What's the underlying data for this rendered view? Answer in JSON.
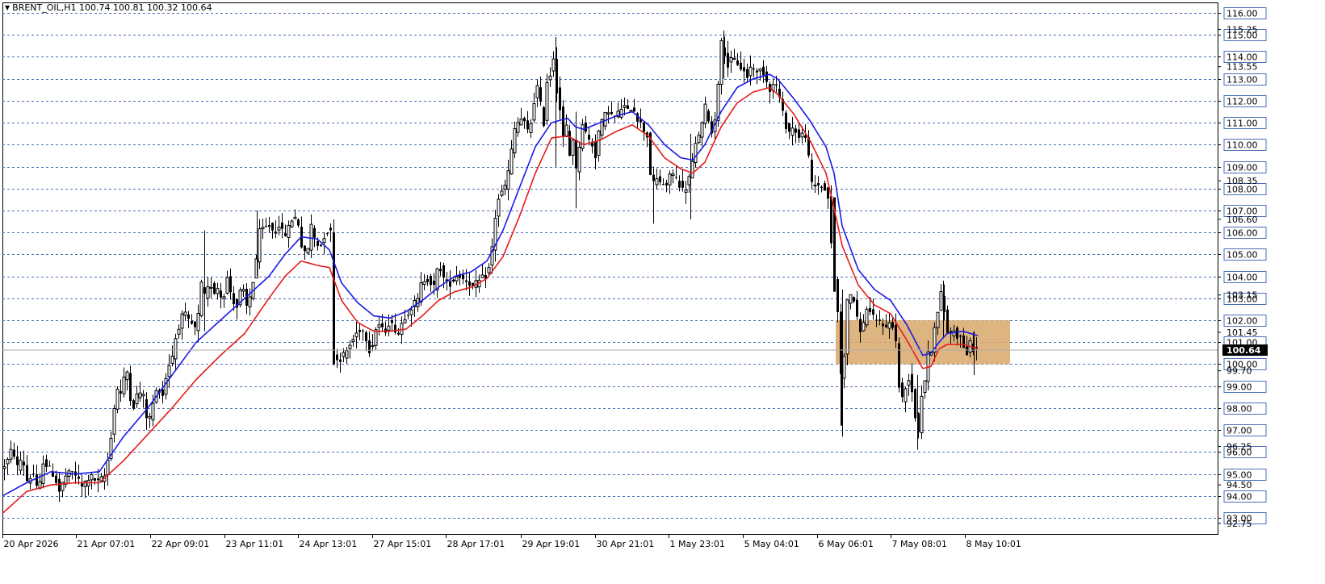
{
  "chart_data": {
    "type": "candlestick",
    "title": "BRENT_OIL,H1",
    "ohlc": {
      "open": "100.74",
      "high": "100.81",
      "low": "100.32",
      "close": "100.64"
    },
    "current_price": "100.64",
    "ylim": [
      92.4,
      116.4
    ],
    "grid_levels": [
      "116.00",
      "115.00",
      "114.00",
      "113.00",
      "112.00",
      "111.00",
      "110.00",
      "109.00",
      "108.00",
      "107.00",
      "106.00",
      "105.00",
      "104.00",
      "103.00",
      "102.00",
      "101.00",
      "100.00",
      "99.00",
      "98.00",
      "97.00",
      "96.00",
      "95.00",
      "94.00",
      "93.00"
    ],
    "minor_ticks": [
      "115.25",
      "113.55",
      "108.35",
      "106.60",
      "103.15",
      "101.45",
      "99.70",
      "96.25",
      "94.50",
      "92.75"
    ],
    "x_ticks": [
      "20 Apr 2026",
      "21 Apr 07:01",
      "22 Apr 09:01",
      "23 Apr 11:01",
      "24 Apr 13:01",
      "27 Apr 15:01",
      "28 Apr 17:01",
      "29 Apr 19:01",
      "30 Apr 21:01",
      "1 May 23:01",
      "5 May 04:01",
      "6 May 06:01",
      "7 May 08:01",
      "8 May 10:01"
    ],
    "price_path": [
      [
        0,
        95.2
      ],
      [
        8,
        95.6
      ],
      [
        14,
        96.2
      ],
      [
        20,
        95.3
      ],
      [
        26,
        95.8
      ],
      [
        32,
        94.7
      ],
      [
        40,
        95.0
      ],
      [
        46,
        94.0
      ],
      [
        52,
        95.6
      ],
      [
        58,
        95.3
      ],
      [
        66,
        94.9
      ],
      [
        72,
        94.2
      ],
      [
        80,
        94.9
      ],
      [
        90,
        95.1
      ],
      [
        100,
        94.4
      ],
      [
        110,
        94.9
      ],
      [
        120,
        94.6
      ],
      [
        128,
        94.9
      ],
      [
        134,
        96.0
      ],
      [
        138,
        97.5
      ],
      [
        142,
        98.5
      ],
      [
        146,
        99.3
      ],
      [
        150,
        98.0
      ],
      [
        154,
        100.6
      ],
      [
        158,
        98.7
      ],
      [
        164,
        98.1
      ],
      [
        170,
        98.8
      ],
      [
        176,
        98.5
      ],
      [
        182,
        97.2
      ],
      [
        188,
        98.2
      ],
      [
        194,
        99.0
      ],
      [
        200,
        98.6
      ],
      [
        206,
        99.8
      ],
      [
        212,
        100.4
      ],
      [
        218,
        101.6
      ],
      [
        222,
        101.9
      ],
      [
        226,
        102.4
      ],
      [
        230,
        102.0
      ],
      [
        236,
        101.8
      ],
      [
        242,
        101.5
      ],
      [
        248,
        103.6
      ],
      [
        254,
        102.8
      ],
      [
        258,
        104.0
      ],
      [
        262,
        103.2
      ],
      [
        268,
        103.5
      ],
      [
        274,
        102.9
      ],
      [
        280,
        103.9
      ],
      [
        286,
        103.0
      ],
      [
        292,
        102.6
      ],
      [
        298,
        103.6
      ],
      [
        304,
        102.6
      ],
      [
        310,
        103.3
      ],
      [
        316,
        104.8
      ],
      [
        320,
        106.0
      ],
      [
        326,
        106.2
      ],
      [
        332,
        106.3
      ],
      [
        338,
        106.0
      ],
      [
        344,
        106.4
      ],
      [
        350,
        105.8
      ],
      [
        356,
        106.2
      ],
      [
        362,
        106.8
      ],
      [
        368,
        106.4
      ],
      [
        372,
        105.4
      ],
      [
        378,
        104.8
      ],
      [
        384,
        106.3
      ],
      [
        390,
        105.5
      ],
      [
        396,
        105.4
      ],
      [
        402,
        106.1
      ],
      [
        408,
        106.0
      ],
      [
        411,
        100.5
      ],
      [
        416,
        100.2
      ],
      [
        422,
        100.3
      ],
      [
        428,
        100.6
      ],
      [
        434,
        101.0
      ],
      [
        440,
        101.4
      ],
      [
        446,
        101.7
      ],
      [
        452,
        101.2
      ],
      [
        458,
        100.4
      ],
      [
        462,
        101.5
      ],
      [
        468,
        101.8
      ],
      [
        474,
        101.4
      ],
      [
        480,
        101.9
      ],
      [
        486,
        101.7
      ],
      [
        492,
        101.4
      ],
      [
        498,
        102.1
      ],
      [
        504,
        102.4
      ],
      [
        510,
        102.7
      ],
      [
        516,
        102.9
      ],
      [
        520,
        103.6
      ],
      [
        526,
        104.0
      ],
      [
        532,
        103.7
      ],
      [
        536,
        103.5
      ],
      [
        542,
        104.6
      ],
      [
        548,
        103.9
      ],
      [
        554,
        103.6
      ],
      [
        560,
        103.9
      ],
      [
        566,
        104.1
      ],
      [
        572,
        103.9
      ],
      [
        578,
        103.8
      ],
      [
        584,
        103.5
      ],
      [
        590,
        103.7
      ],
      [
        596,
        103.9
      ],
      [
        602,
        104.1
      ],
      [
        606,
        104.6
      ],
      [
        610,
        106.0
      ],
      [
        614,
        107.4
      ],
      [
        618,
        107.7
      ],
      [
        622,
        107.9
      ],
      [
        626,
        108.3
      ],
      [
        630,
        109.2
      ],
      [
        634,
        110.2
      ],
      [
        638,
        111.2
      ],
      [
        642,
        110.8
      ],
      [
        646,
        111.5
      ],
      [
        650,
        110.4
      ],
      [
        656,
        111.0
      ],
      [
        660,
        112.0
      ],
      [
        664,
        112.6
      ],
      [
        668,
        111.8
      ],
      [
        672,
        111.0
      ],
      [
        676,
        112.9
      ],
      [
        680,
        113.2
      ],
      [
        684,
        114.0
      ],
      [
        688,
        112.5
      ],
      [
        692,
        111.6
      ],
      [
        696,
        110.3
      ],
      [
        700,
        110.8
      ],
      [
        704,
        109.5
      ],
      [
        708,
        110.3
      ],
      [
        712,
        108.8
      ],
      [
        716,
        110.0
      ],
      [
        720,
        111.0
      ],
      [
        726,
        110.3
      ],
      [
        732,
        110.0
      ],
      [
        736,
        109.5
      ],
      [
        740,
        110.6
      ],
      [
        746,
        111.2
      ],
      [
        752,
        111.6
      ],
      [
        758,
        111.2
      ],
      [
        764,
        111.4
      ],
      [
        770,
        111.8
      ],
      [
        776,
        111.5
      ],
      [
        782,
        111.8
      ],
      [
        788,
        111.2
      ],
      [
        794,
        110.8
      ],
      [
        800,
        110.4
      ],
      [
        804,
        108.7
      ],
      [
        808,
        108.2
      ],
      [
        812,
        108.4
      ],
      [
        818,
        108.3
      ],
      [
        824,
        108.0
      ],
      [
        828,
        108.7
      ],
      [
        834,
        108.6
      ],
      [
        840,
        108.2
      ],
      [
        846,
        107.8
      ],
      [
        850,
        108.3
      ],
      [
        854,
        108.7
      ],
      [
        858,
        109.6
      ],
      [
        862,
        110.3
      ],
      [
        868,
        110.9
      ],
      [
        872,
        111.7
      ],
      [
        876,
        111.2
      ],
      [
        880,
        110.5
      ],
      [
        884,
        111.2
      ],
      [
        888,
        112.9
      ],
      [
        892,
        114.6
      ],
      [
        896,
        114.2
      ],
      [
        900,
        113.6
      ],
      [
        906,
        113.9
      ],
      [
        912,
        113.7
      ],
      [
        918,
        113.4
      ],
      [
        924,
        113.1
      ],
      [
        930,
        113.7
      ],
      [
        936,
        113.2
      ],
      [
        942,
        113.5
      ],
      [
        948,
        112.9
      ],
      [
        954,
        112.4
      ],
      [
        958,
        113.0
      ],
      [
        962,
        112.4
      ],
      [
        966,
        111.8
      ],
      [
        970,
        111.0
      ],
      [
        976,
        110.6
      ],
      [
        982,
        110.8
      ],
      [
        988,
        110.3
      ],
      [
        994,
        110.5
      ],
      [
        998,
        110.4
      ],
      [
        1002,
        108.3
      ],
      [
        1006,
        108.1
      ],
      [
        1010,
        108.2
      ],
      [
        1016,
        108.1
      ],
      [
        1020,
        107.9
      ],
      [
        1024,
        107.6
      ],
      [
        1028,
        105.4
      ],
      [
        1032,
        103.8
      ],
      [
        1036,
        102.4
      ],
      [
        1040,
        99.5
      ],
      [
        1044,
        100.5
      ],
      [
        1048,
        102.8
      ],
      [
        1052,
        103.2
      ],
      [
        1056,
        102.9
      ],
      [
        1060,
        102.0
      ],
      [
        1064,
        101.6
      ],
      [
        1068,
        101.8
      ],
      [
        1072,
        102.6
      ],
      [
        1078,
        102.2
      ],
      [
        1084,
        101.9
      ],
      [
        1090,
        102.0
      ],
      [
        1096,
        101.6
      ],
      [
        1100,
        101.9
      ],
      [
        1104,
        101.8
      ],
      [
        1108,
        101.0
      ],
      [
        1112,
        99.0
      ],
      [
        1116,
        98.4
      ],
      [
        1120,
        98.9
      ],
      [
        1124,
        99.4
      ],
      [
        1128,
        98.8
      ],
      [
        1132,
        97.6
      ],
      [
        1136,
        97.0
      ],
      [
        1140,
        98.6
      ],
      [
        1144,
        99.3
      ],
      [
        1148,
        100.4
      ],
      [
        1152,
        100.7
      ],
      [
        1156,
        101.8
      ],
      [
        1160,
        102.3
      ],
      [
        1164,
        103.2
      ],
      [
        1168,
        102.4
      ],
      [
        1172,
        101.5
      ],
      [
        1176,
        101.4
      ],
      [
        1180,
        101.6
      ],
      [
        1184,
        101.3
      ],
      [
        1188,
        101.2
      ],
      [
        1192,
        100.8
      ],
      [
        1196,
        100.5
      ],
      [
        1200,
        100.9
      ],
      [
        1204,
        100.7
      ],
      [
        1208,
        100.64
      ]
    ],
    "blue_ma": [
      [
        0,
        94.0
      ],
      [
        30,
        94.6
      ],
      [
        60,
        95.1
      ],
      [
        90,
        95.0
      ],
      [
        120,
        95.1
      ],
      [
        150,
        96.7
      ],
      [
        180,
        98.0
      ],
      [
        210,
        99.5
      ],
      [
        240,
        101.0
      ],
      [
        270,
        102.0
      ],
      [
        300,
        103.0
      ],
      [
        330,
        104.0
      ],
      [
        350,
        105.0
      ],
      [
        370,
        105.8
      ],
      [
        390,
        105.7
      ],
      [
        405,
        105.2
      ],
      [
        420,
        103.7
      ],
      [
        440,
        102.8
      ],
      [
        460,
        102.2
      ],
      [
        480,
        102.1
      ],
      [
        500,
        102.4
      ],
      [
        520,
        102.9
      ],
      [
        540,
        103.5
      ],
      [
        560,
        104.0
      ],
      [
        580,
        104.2
      ],
      [
        600,
        104.7
      ],
      [
        620,
        106.1
      ],
      [
        640,
        108.0
      ],
      [
        660,
        109.9
      ],
      [
        680,
        111.0
      ],
      [
        700,
        111.2
      ],
      [
        710,
        110.8
      ],
      [
        720,
        110.7
      ],
      [
        740,
        111.0
      ],
      [
        760,
        111.3
      ],
      [
        780,
        111.5
      ],
      [
        800,
        110.9
      ],
      [
        820,
        110.0
      ],
      [
        840,
        109.4
      ],
      [
        855,
        109.3
      ],
      [
        870,
        110.0
      ],
      [
        890,
        111.5
      ],
      [
        910,
        112.6
      ],
      [
        930,
        113.0
      ],
      [
        950,
        113.2
      ],
      [
        960,
        113.0
      ],
      [
        980,
        112.1
      ],
      [
        1000,
        111.1
      ],
      [
        1020,
        109.9
      ],
      [
        1030,
        108.7
      ],
      [
        1040,
        106.3
      ],
      [
        1060,
        104.3
      ],
      [
        1080,
        103.4
      ],
      [
        1100,
        102.9
      ],
      [
        1120,
        101.8
      ],
      [
        1140,
        100.4
      ],
      [
        1150,
        100.5
      ],
      [
        1160,
        101.0
      ],
      [
        1170,
        101.4
      ],
      [
        1190,
        101.5
      ],
      [
        1208,
        101.3
      ]
    ],
    "red_ma": [
      [
        0,
        93.2
      ],
      [
        30,
        94.2
      ],
      [
        60,
        94.5
      ],
      [
        90,
        94.6
      ],
      [
        120,
        94.6
      ],
      [
        150,
        95.6
      ],
      [
        180,
        96.8
      ],
      [
        210,
        98.0
      ],
      [
        240,
        99.3
      ],
      [
        270,
        100.4
      ],
      [
        300,
        101.4
      ],
      [
        330,
        103.0
      ],
      [
        350,
        104.0
      ],
      [
        370,
        104.7
      ],
      [
        390,
        104.5
      ],
      [
        405,
        104.4
      ],
      [
        420,
        102.9
      ],
      [
        440,
        101.9
      ],
      [
        460,
        101.5
      ],
      [
        480,
        101.5
      ],
      [
        500,
        101.6
      ],
      [
        520,
        102.2
      ],
      [
        540,
        102.9
      ],
      [
        560,
        103.3
      ],
      [
        580,
        103.5
      ],
      [
        600,
        103.9
      ],
      [
        620,
        104.9
      ],
      [
        640,
        106.7
      ],
      [
        660,
        108.7
      ],
      [
        680,
        110.3
      ],
      [
        700,
        110.4
      ],
      [
        720,
        110.0
      ],
      [
        740,
        110.2
      ],
      [
        760,
        110.6
      ],
      [
        780,
        110.9
      ],
      [
        800,
        110.4
      ],
      [
        820,
        109.4
      ],
      [
        840,
        108.9
      ],
      [
        855,
        108.7
      ],
      [
        870,
        109.2
      ],
      [
        890,
        110.8
      ],
      [
        910,
        111.9
      ],
      [
        930,
        112.4
      ],
      [
        950,
        112.6
      ],
      [
        960,
        112.3
      ],
      [
        980,
        111.4
      ],
      [
        1000,
        110.2
      ],
      [
        1020,
        108.7
      ],
      [
        1030,
        107.1
      ],
      [
        1040,
        105.4
      ],
      [
        1060,
        103.6
      ],
      [
        1080,
        102.7
      ],
      [
        1100,
        102.3
      ],
      [
        1120,
        101.1
      ],
      [
        1140,
        99.8
      ],
      [
        1150,
        99.9
      ],
      [
        1160,
        100.7
      ],
      [
        1170,
        100.9
      ],
      [
        1190,
        100.9
      ],
      [
        1208,
        100.7
      ]
    ],
    "zone": {
      "x0": 1032,
      "x1": 1248,
      "from": 100.0,
      "to": 102.0
    },
    "colors": {
      "candle": "#000000",
      "grid": "#4a6fb5",
      "blue_ma": "#1a1ae6",
      "red_ma": "#e61a1a",
      "zone": "#d8a86b",
      "price_badge": "#000000",
      "current_line": "#aaaaaa"
    },
    "grid": true
  }
}
